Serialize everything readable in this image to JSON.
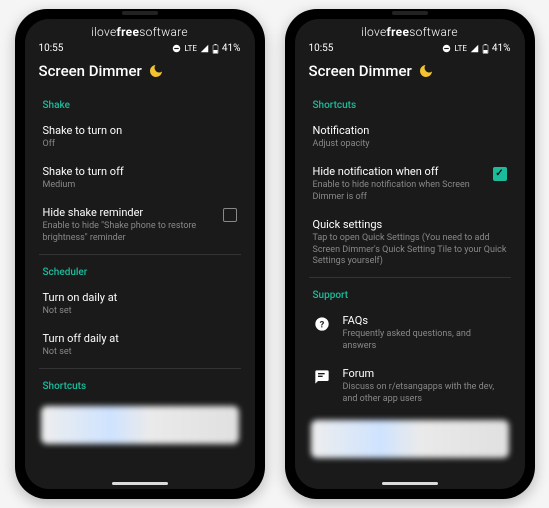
{
  "watermark_plain": "ilove",
  "watermark_bold": "free",
  "watermark_tail": "software",
  "status": {
    "time": "10:55",
    "network": "LTE",
    "signal_icon": "signal-icon",
    "battery_pct": "41%"
  },
  "app": {
    "title": "Screen Dimmer"
  },
  "left": {
    "sections": {
      "shake": {
        "header": "Shake",
        "items": [
          {
            "title": "Shake to turn on",
            "sub": "Off"
          },
          {
            "title": "Shake to turn off",
            "sub": "Medium"
          },
          {
            "title": "Hide shake reminder",
            "sub": "Enable to hide \"Shake phone to restore brightness\" reminder",
            "checkbox": false
          }
        ]
      },
      "scheduler": {
        "header": "Scheduler",
        "items": [
          {
            "title": "Turn on daily at",
            "sub": "Not set"
          },
          {
            "title": "Turn off daily at",
            "sub": "Not set"
          }
        ]
      },
      "shortcuts": {
        "header": "Shortcuts"
      }
    }
  },
  "right": {
    "sections": {
      "shortcuts": {
        "header": "Shortcuts",
        "items": [
          {
            "title": "Notification",
            "sub": "Adjust opacity"
          },
          {
            "title": "Hide notification when off",
            "sub": "Enable to hide notification when Screen Dimmer is off",
            "checkbox": true
          },
          {
            "title": "Quick settings",
            "sub": "Tap to open Quick Settings (You need to add Screen Dimmer's Quick Setting Tile to your Quick Settings yourself)"
          }
        ]
      },
      "support": {
        "header": "Support",
        "items": [
          {
            "icon": "help-icon",
            "title": "FAQs",
            "sub": "Frequently asked questions, and answers"
          },
          {
            "icon": "forum-icon",
            "title": "Forum",
            "sub": "Discuss on r/etsangapps with the dev, and other app users"
          }
        ]
      }
    }
  }
}
